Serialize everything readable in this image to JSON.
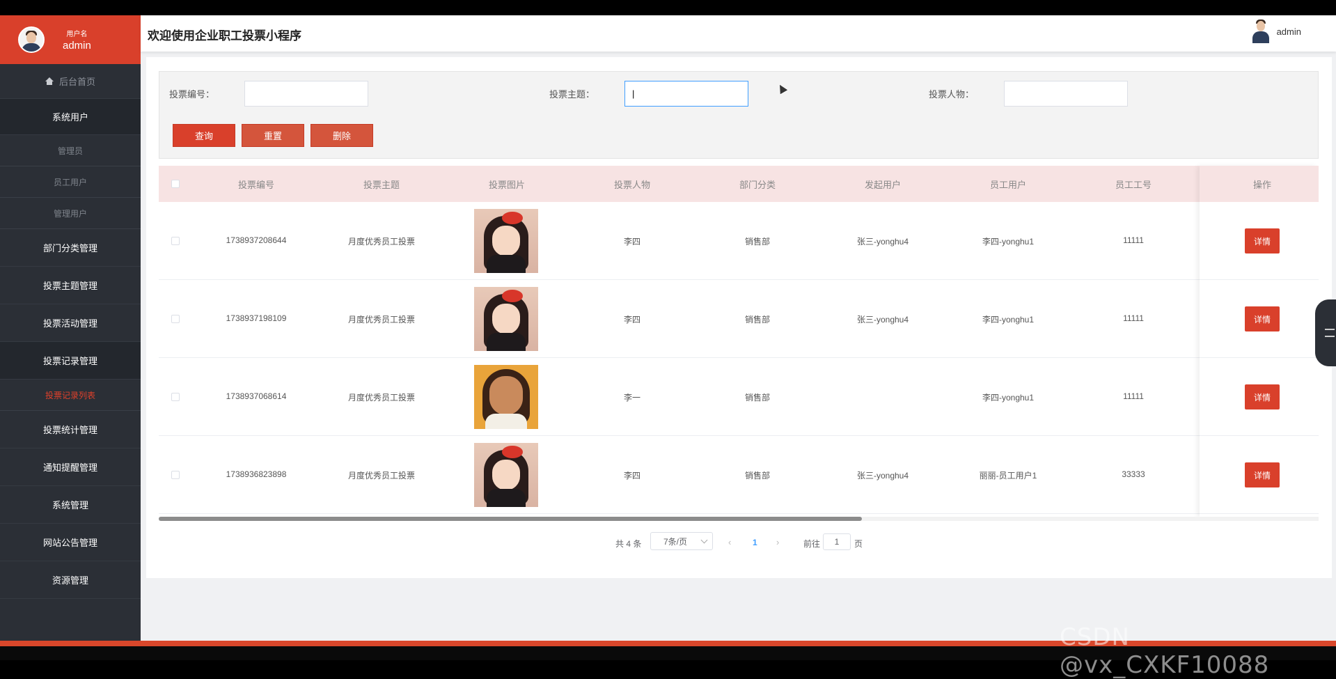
{
  "sidebar": {
    "user_label": "用户名",
    "user_name": "admin",
    "home": "后台首页",
    "items": [
      {
        "label": "系统用户",
        "subs": [
          "管理员",
          "员工用户",
          "管理用户"
        ]
      },
      {
        "label": "部门分类管理"
      },
      {
        "label": "投票主题管理"
      },
      {
        "label": "投票活动管理"
      },
      {
        "label": "投票记录管理",
        "subs": [
          "投票记录列表"
        ]
      },
      {
        "label": "投票统计管理"
      },
      {
        "label": "通知提醒管理"
      },
      {
        "label": "系统管理"
      },
      {
        "label": "网站公告管理"
      },
      {
        "label": "资源管理"
      }
    ]
  },
  "header": {
    "title": "欢迎使用企业职工投票小程序",
    "user": "admin"
  },
  "search": {
    "label1": "投票编号：",
    "label2": "投票主题：",
    "label3": "投票人物：",
    "value1": "",
    "value2": "|",
    "value3": "",
    "btn_query": "查询",
    "btn_reset": "重置",
    "btn_delete": "删除"
  },
  "table": {
    "columns": [
      "投票编号",
      "投票主题",
      "投票图片",
      "投票人物",
      "部门分类",
      "发起用户",
      "员工用户",
      "员工工号",
      "操作"
    ],
    "rows": [
      {
        "id": "1738937208644",
        "topic": "月度优秀员工投票",
        "person": "李四",
        "dept": "销售部",
        "initiator": "张三-yonghu4",
        "employee": "李四-yonghu1",
        "emp_no": "11111",
        "action": "详情"
      },
      {
        "id": "1738937198109",
        "topic": "月度优秀员工投票",
        "person": "李四",
        "dept": "销售部",
        "initiator": "张三-yonghu4",
        "employee": "李四-yonghu1",
        "emp_no": "11111",
        "action": "详情"
      },
      {
        "id": "1738937068614",
        "topic": "月度优秀员工投票",
        "person": "李一",
        "dept": "销售部",
        "initiator": "",
        "employee": "李四-yonghu1",
        "emp_no": "11111",
        "action": "详情"
      },
      {
        "id": "1738936823898",
        "topic": "月度优秀员工投票",
        "person": "李四",
        "dept": "销售部",
        "initiator": "张三-yonghu4",
        "employee": "丽丽-员工用户1",
        "emp_no": "33333",
        "action": "详情"
      }
    ]
  },
  "pager": {
    "total": "共 4 条",
    "size": "7条/页",
    "prev": "‹",
    "page": "1",
    "next": "›",
    "goto": "前往",
    "goto_value": "1",
    "unit": "页"
  },
  "watermark": "CSDN @vx_CXKF10088",
  "colors": {
    "accent": "#d9402b",
    "sidebar": "#2b2f36",
    "table_header": "#f7e3e3"
  }
}
